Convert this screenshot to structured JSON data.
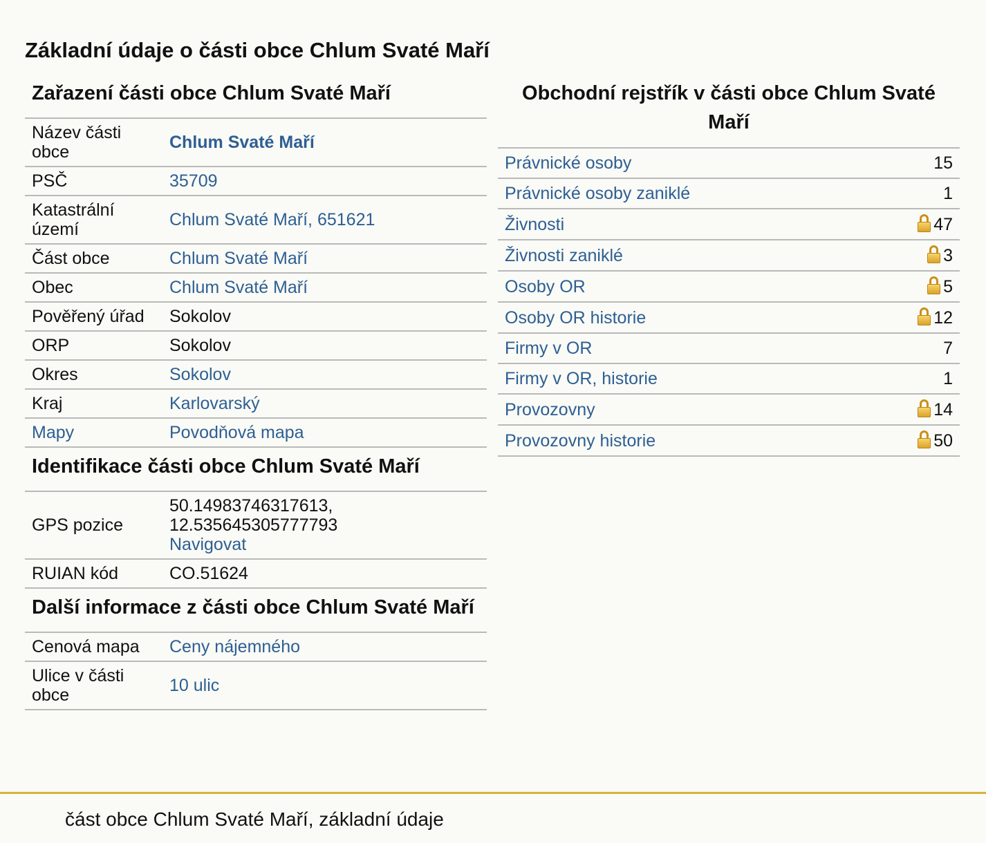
{
  "page_title": "Základní údaje o části obce Chlum Svaté Maří",
  "zarazeni": {
    "heading": "Zařazení části obce Chlum Svaté Maří",
    "rows": [
      {
        "label": "Název části obce",
        "value": "Chlum Svaté Maří"
      },
      {
        "label": "PSČ",
        "value": "35709"
      },
      {
        "label": "Katastrální území",
        "value": "Chlum Svaté Maří, 651621"
      },
      {
        "label": "Část obce",
        "value": "Chlum Svaté Maří"
      },
      {
        "label": "Obec",
        "value": "Chlum Svaté Maří"
      },
      {
        "label": "Pověřený úřad",
        "value": "Sokolov"
      },
      {
        "label": "ORP",
        "value": "Sokolov"
      },
      {
        "label": "Okres",
        "value": "Sokolov"
      },
      {
        "label": "Kraj",
        "value": "Karlovarský"
      },
      {
        "label": "Mapy",
        "value": "Povodňová mapa"
      }
    ]
  },
  "identifikace": {
    "heading": "Identifikace části obce Chlum Svaté Maří",
    "rows": [
      {
        "label": "GPS pozice",
        "value": "50.14983746317613,",
        "value2": "12.535645305777793",
        "link": "Navigovat"
      },
      {
        "label": "RUIAN kód",
        "value": "CO.51624"
      }
    ]
  },
  "dalsi": {
    "heading": "Další informace z části obce Chlum Svaté Maří",
    "rows": [
      {
        "label": "Cenová mapa",
        "value": "Ceny nájemného"
      },
      {
        "label": "Ulice v části obce",
        "value": "10 ulic"
      }
    ]
  },
  "rejstrik": {
    "heading": "Obchodní rejstřík v části obce Chlum Svaté Maří",
    "rows": [
      {
        "label": "Právnické osoby",
        "count": "15",
        "locked": false
      },
      {
        "label": "Právnické osoby zaniklé",
        "count": "1",
        "locked": false
      },
      {
        "label": "Živnosti",
        "count": "47",
        "locked": true
      },
      {
        "label": "Živnosti zaniklé",
        "count": "3",
        "locked": true
      },
      {
        "label": "Osoby OR",
        "count": "5",
        "locked": true
      },
      {
        "label": "Osoby OR historie",
        "count": "12",
        "locked": true
      },
      {
        "label": "Firmy v OR",
        "count": "7",
        "locked": false
      },
      {
        "label": "Firmy v OR, historie",
        "count": "1",
        "locked": false
      },
      {
        "label": "Provozovny",
        "count": "14",
        "locked": true
      },
      {
        "label": "Provozovny historie",
        "count": "50",
        "locked": true
      }
    ]
  },
  "footer": {
    "text": "část obce Chlum Svaté Maří, základní údaje",
    "accent_color": "#d6b33a"
  },
  "colors": {
    "link": "#2d5f93",
    "background": "#fafaf6"
  }
}
